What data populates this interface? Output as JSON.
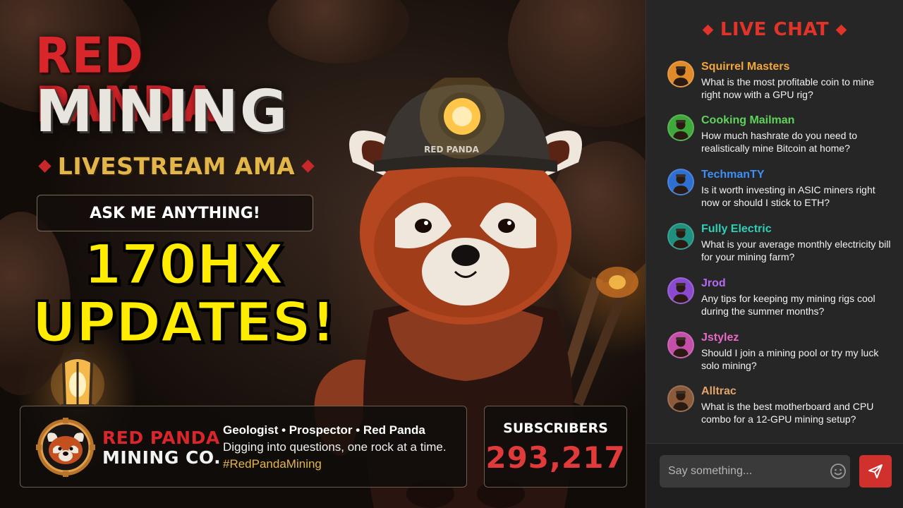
{
  "title": {
    "line1": "RED PANDA",
    "line2": "MINING",
    "subtitle": "LIVESTREAM AMA"
  },
  "ask_banner": "ASK ME ANYTHING!",
  "headline": {
    "line1": "170HX",
    "line2": "UPDATES!"
  },
  "helmet_text": "RED PANDA",
  "channel": {
    "brand_line1": "RED PANDA",
    "brand_line2": "MINING CO.",
    "tagline": "Geologist • Prospector • Red Panda",
    "description": "Digging into questions, one rock at a time.",
    "hashtag": "#RedPandaMining"
  },
  "subscribers": {
    "label": "SUBSCRIBERS",
    "count": "293,217"
  },
  "chat": {
    "title": "LIVE CHAT",
    "messages": [
      {
        "user": "Squirrel Masters",
        "text": "What is the most profitable coin to mine right now with a GPU rig?",
        "color": "#f2a63a",
        "avatar_bg": "#e08a2a"
      },
      {
        "user": "Cooking Mailman",
        "text": "How much hashrate do you need to realistically mine Bitcoin at home?",
        "color": "#5fd35a",
        "avatar_bg": "#3fa83a"
      },
      {
        "user": "TechmanTY",
        "text": "Is it worth investing in ASIC miners right now or should I stick to ETH?",
        "color": "#3f8ef5",
        "avatar_bg": "#2f6fd0"
      },
      {
        "user": "Fully Electric",
        "text": "What is your average monthly electricity bill for your mining farm?",
        "color": "#2fcfb8",
        "avatar_bg": "#1f8f80"
      },
      {
        "user": "Jrod",
        "text": "Any tips for keeping my mining rigs cool during the summer months?",
        "color": "#b46bf2",
        "avatar_bg": "#8a4ad0"
      },
      {
        "user": "Jstylez",
        "text": "Should I join a mining pool or try my luck solo mining?",
        "color": "#e86bc8",
        "avatar_bg": "#c44fa8"
      },
      {
        "user": "Alltrac",
        "text": "What is the best motherboard and CPU combo for a 12-GPU mining setup?",
        "color": "#e3a46a",
        "avatar_bg": "#8a5a3a"
      }
    ],
    "input_placeholder": "Say something..."
  },
  "colors": {
    "brand_red": "#d8262b",
    "headline_yellow": "#ffec00",
    "accent_gold": "#e3b64a",
    "send_button": "#d0312d"
  }
}
